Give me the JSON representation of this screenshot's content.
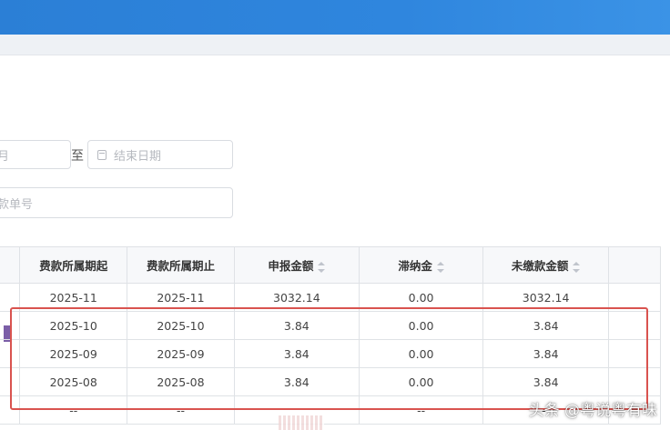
{
  "filters": {
    "start_date_partial": "月",
    "to_label": "至",
    "end_date_placeholder": "结束日期",
    "doc_number_partial": "款单号"
  },
  "table": {
    "headers": [
      "费款所属期起",
      "费款所属期止",
      "申报金额",
      "滞纳金",
      "未缴款金额"
    ],
    "rows": [
      [
        "2025-11",
        "2025-11",
        "3032.14",
        "0.00",
        "3032.14"
      ],
      [
        "2025-10",
        "2025-10",
        "3.84",
        "0.00",
        "3.84"
      ],
      [
        "2025-09",
        "2025-09",
        "3.84",
        "0.00",
        "3.84"
      ],
      [
        "2025-08",
        "2025-08",
        "3.84",
        "0.00",
        "3.84"
      ],
      [
        "--",
        "--",
        "",
        "--",
        "--"
      ]
    ]
  },
  "watermark": "头条 @粤说粤有味"
}
